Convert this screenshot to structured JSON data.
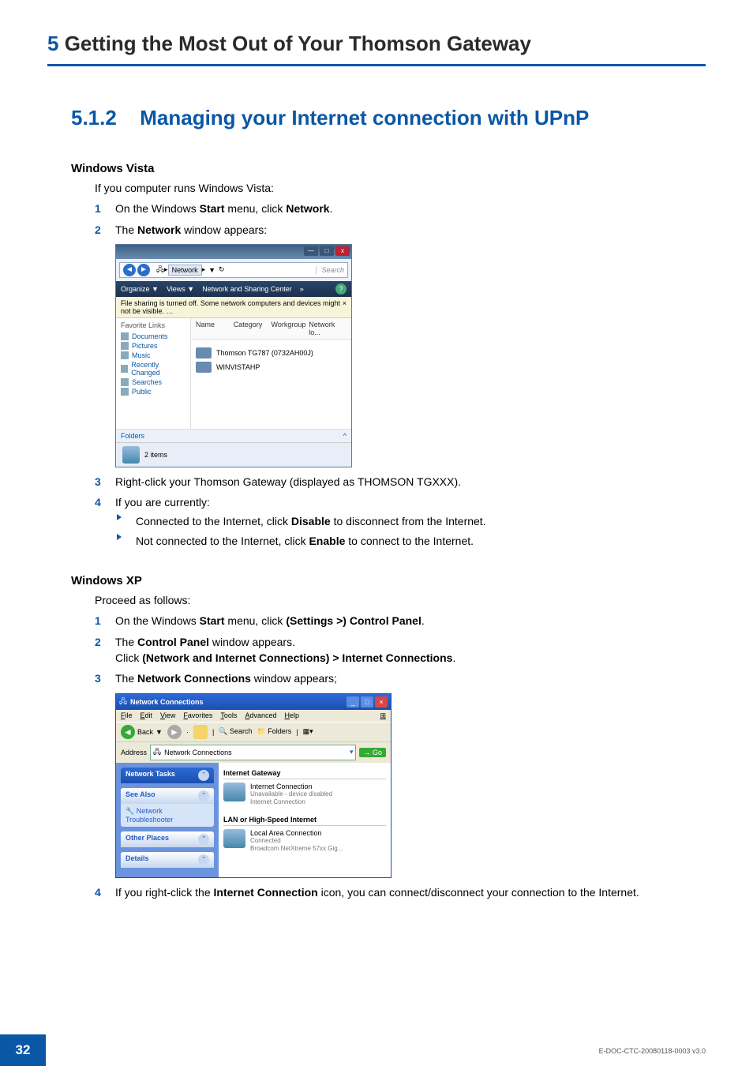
{
  "chapter": {
    "num": "5",
    "title": "Getting the Most Out of Your Thomson Gateway"
  },
  "section": {
    "num": "5.1.2",
    "title": "Managing your Internet connection with UPnP"
  },
  "vista": {
    "heading": "Windows Vista",
    "intro": "If you computer runs Windows Vista:",
    "step1_a": "On the Windows ",
    "step1_b": "Start",
    "step1_c": " menu, click ",
    "step1_d": "Network",
    "step1_e": ".",
    "step2_a": "The ",
    "step2_b": "Network",
    "step2_c": " window appears:",
    "step3": "Right-click your Thomson Gateway (displayed as THOMSON TGXXX).",
    "step4": "If you are currently:",
    "bullet1_a": "Connected to the Internet, click ",
    "bullet1_b": "Disable",
    "bullet1_c": " to disconnect from the Internet.",
    "bullet2_a": "Not connected to the Internet, click ",
    "bullet2_b": "Enable",
    "bullet2_c": " to connect to the Internet."
  },
  "vista_window": {
    "title_min": "—",
    "title_max": "□",
    "title_close": "x",
    "breadcrumb": "Network",
    "breadcrumb_sep": "▸",
    "search_placeholder": "Search",
    "toolbar": {
      "organize": "Organize ▼",
      "views": "Views ▼",
      "sharing": "Network and Sharing Center",
      "more": "»",
      "help": "?"
    },
    "infobar": "File sharing is turned off. Some network computers and devices might not be visible. …",
    "infobar_close": "×",
    "side_heading": "Favorite Links",
    "side_links": [
      "Documents",
      "Pictures",
      "Music",
      "Recently Changed",
      "Searches",
      "Public"
    ],
    "folders": "Folders",
    "folders_chev": "^",
    "cols": [
      "Name",
      "Category",
      "Workgroup",
      "Network lo..."
    ],
    "item1": "Thomson TG787 (0732AH00J)",
    "item2": "WINVISTAHP",
    "status": "2 items"
  },
  "xp": {
    "heading": "Windows XP",
    "intro": "Proceed as follows:",
    "step1_a": "On the Windows ",
    "step1_b": "Start",
    "step1_c": " menu, click ",
    "step1_d": "(Settings >) Control Panel",
    "step1_e": ".",
    "step2_a": "The ",
    "step2_b": "Control Panel",
    "step2_c": " window appears.",
    "step2_d": "Click ",
    "step2_e": "(Network and Internet Connections) > Internet Connections",
    "step2_f": ".",
    "step3_a": "The ",
    "step3_b": "Network Connections",
    "step3_c": " window appears;",
    "step4_a": "If you right-click the ",
    "step4_b": "Internet Connection",
    "step4_c": " icon, you can connect/disconnect your connection to the Internet."
  },
  "xp_window": {
    "title": "Network Connections",
    "title_min": "_",
    "title_max": "□",
    "title_close": "×",
    "menu": [
      "File",
      "Edit",
      "View",
      "Favorites",
      "Tools",
      "Advanced",
      "Help"
    ],
    "back": "Back",
    "back_sep": "▼",
    "tb_search": "Search",
    "tb_folders": "Folders",
    "addr_label": "Address",
    "addr_value": "Network Connections",
    "go": "Go",
    "panels": {
      "tasks": "Network Tasks",
      "seealso": "See Also",
      "seealso_item": "Network Troubleshooter",
      "other": "Other Places",
      "details": "Details"
    },
    "group1": "Internet Gateway",
    "conn1": {
      "name": "Internet Connection",
      "status": "Unavailable - device disabled",
      "via": "Internet Connection"
    },
    "group2": "LAN or High-Speed Internet",
    "conn2": {
      "name": "Local Area Connection",
      "status": "Connected",
      "via": "Broadcom NetXtreme 57xx Gig..."
    }
  },
  "footer": {
    "page": "32",
    "docref": "E-DOC-CTC-20080118-0003 v3.0"
  }
}
